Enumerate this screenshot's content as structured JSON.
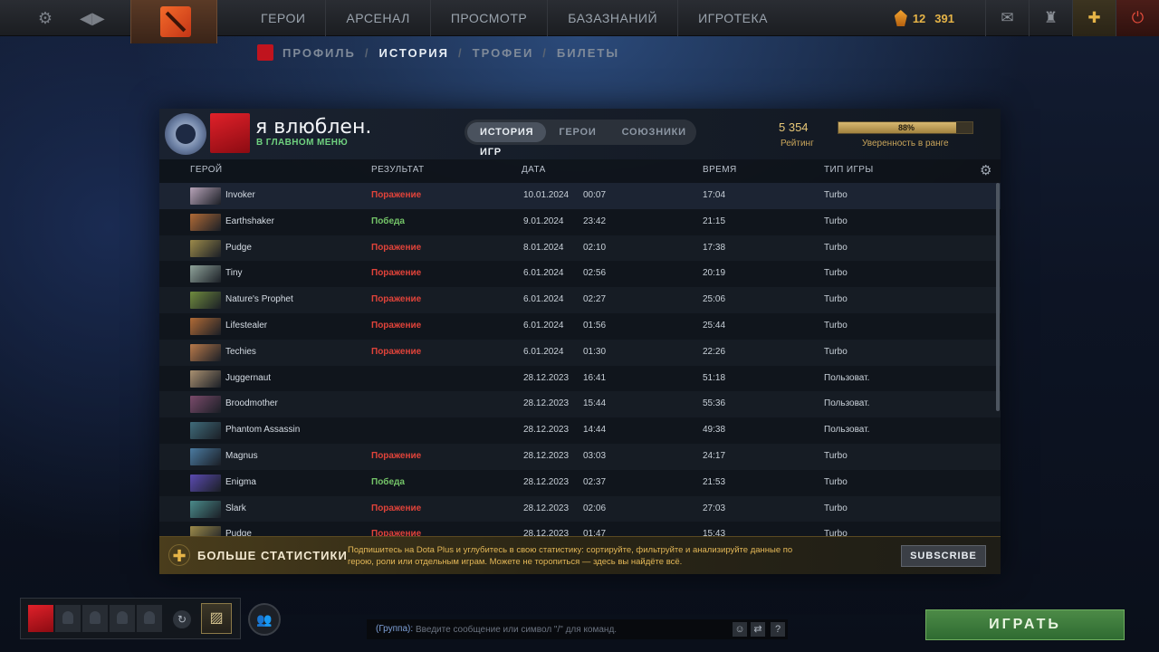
{
  "nav": {
    "items": [
      "ГЕРОИ",
      "АРСЕНАЛ",
      "ПРОСМОТР",
      "БАЗАЗНАНИЙ",
      "ИГРОТЕКА"
    ],
    "shards_level": "12",
    "shards_value": "391"
  },
  "subnav": {
    "profile": "ПРОФИЛЬ",
    "history": "ИСТОРИЯ",
    "trophies": "ТРОФЕИ",
    "tickets": "БИЛЕТЫ",
    "sep": "/"
  },
  "player": {
    "name": "я влюблен.",
    "status": "В ГЛАВНОМ МЕНЮ"
  },
  "tabs": [
    "ИСТОРИЯ ИГР",
    "ГЕРОИ",
    "СОЮЗНИКИ"
  ],
  "rating": {
    "value": "5 354",
    "label": "Рейтинг"
  },
  "confidence": {
    "text": "88%",
    "label": "Уверенность в ранге",
    "fill_fraction": 0.88
  },
  "columns": {
    "hero": "ГЕРОЙ",
    "result": "РЕЗУЛЬТАТ",
    "date": "ДАТА",
    "duration": "ВРЕМЯ",
    "type": "ТИП ИГРЫ"
  },
  "matches": [
    {
      "hero": "Invoker",
      "result": "Поражение",
      "outcome": "loss",
      "date": "10.01.2024",
      "time": "00:07",
      "duration": "17:04",
      "type": "Turbo",
      "color": "#b7a3b8"
    },
    {
      "hero": "Earthshaker",
      "result": "Победа",
      "outcome": "win",
      "date": "9.01.2024",
      "time": "23:42",
      "duration": "21:15",
      "type": "Turbo",
      "color": "#b06a36"
    },
    {
      "hero": "Pudge",
      "result": "Поражение",
      "outcome": "loss",
      "date": "8.01.2024",
      "time": "02:10",
      "duration": "17:38",
      "type": "Turbo",
      "color": "#9c8a4a"
    },
    {
      "hero": "Tiny",
      "result": "Поражение",
      "outcome": "loss",
      "date": "6.01.2024",
      "time": "02:56",
      "duration": "20:19",
      "type": "Turbo",
      "color": "#8fa39a"
    },
    {
      "hero": "Nature's Prophet",
      "result": "Поражение",
      "outcome": "loss",
      "date": "6.01.2024",
      "time": "02:27",
      "duration": "25:06",
      "type": "Turbo",
      "color": "#6f8b3e"
    },
    {
      "hero": "Lifestealer",
      "result": "Поражение",
      "outcome": "loss",
      "date": "6.01.2024",
      "time": "01:56",
      "duration": "25:44",
      "type": "Turbo",
      "color": "#b06a36"
    },
    {
      "hero": "Techies",
      "result": "Поражение",
      "outcome": "loss",
      "date": "6.01.2024",
      "time": "01:30",
      "duration": "22:26",
      "type": "Turbo",
      "color": "#b8794a"
    },
    {
      "hero": "Juggernaut",
      "result": "",
      "outcome": "none",
      "date": "28.12.2023",
      "time": "16:41",
      "duration": "51:18",
      "type": "Пользоват.",
      "color": "#a99070"
    },
    {
      "hero": "Broodmother",
      "result": "",
      "outcome": "none",
      "date": "28.12.2023",
      "time": "15:44",
      "duration": "55:36",
      "type": "Пользоват.",
      "color": "#7a4a6a"
    },
    {
      "hero": "Phantom Assassin",
      "result": "",
      "outcome": "none",
      "date": "28.12.2023",
      "time": "14:44",
      "duration": "49:38",
      "type": "Пользоват.",
      "color": "#3f6b7a"
    },
    {
      "hero": "Magnus",
      "result": "Поражение",
      "outcome": "loss",
      "date": "28.12.2023",
      "time": "03:03",
      "duration": "24:17",
      "type": "Turbo",
      "color": "#4a7aa0"
    },
    {
      "hero": "Enigma",
      "result": "Победа",
      "outcome": "win",
      "date": "28.12.2023",
      "time": "02:37",
      "duration": "21:53",
      "type": "Turbo",
      "color": "#5a4ab0"
    },
    {
      "hero": "Slark",
      "result": "Поражение",
      "outcome": "loss",
      "date": "28.12.2023",
      "time": "02:06",
      "duration": "27:03",
      "type": "Turbo",
      "color": "#4a8a8a"
    },
    {
      "hero": "Pudge",
      "result": "Поражение",
      "outcome": "loss",
      "date": "28.12.2023",
      "time": "01:47",
      "duration": "15:43",
      "type": "Turbo",
      "color": "#9c8a4a"
    }
  ],
  "dplus": {
    "title": "БОЛЬШЕ СТАТИСТИКИ",
    "desc": "Подпишитесь на Dota Plus и углубитесь в свою статистику: сортируйте, фильтруйте и анализируйте данные по герою, роли или отдельным играм. Можете не торопиться — здесь вы найдёте всё.",
    "button": "SUBSCRIBE"
  },
  "chat": {
    "label": "(Группа):",
    "placeholder": "Введите сообщение или символ \"/\" для команд.",
    "help": "?"
  },
  "play": "ИГРАТЬ",
  "icons": {
    "settings": "gear-icon",
    "back": "back-icon",
    "mail": "mail-icon",
    "armory": "armory-icon",
    "dota_plus": "dota-plus-icon",
    "power": "power-icon"
  }
}
